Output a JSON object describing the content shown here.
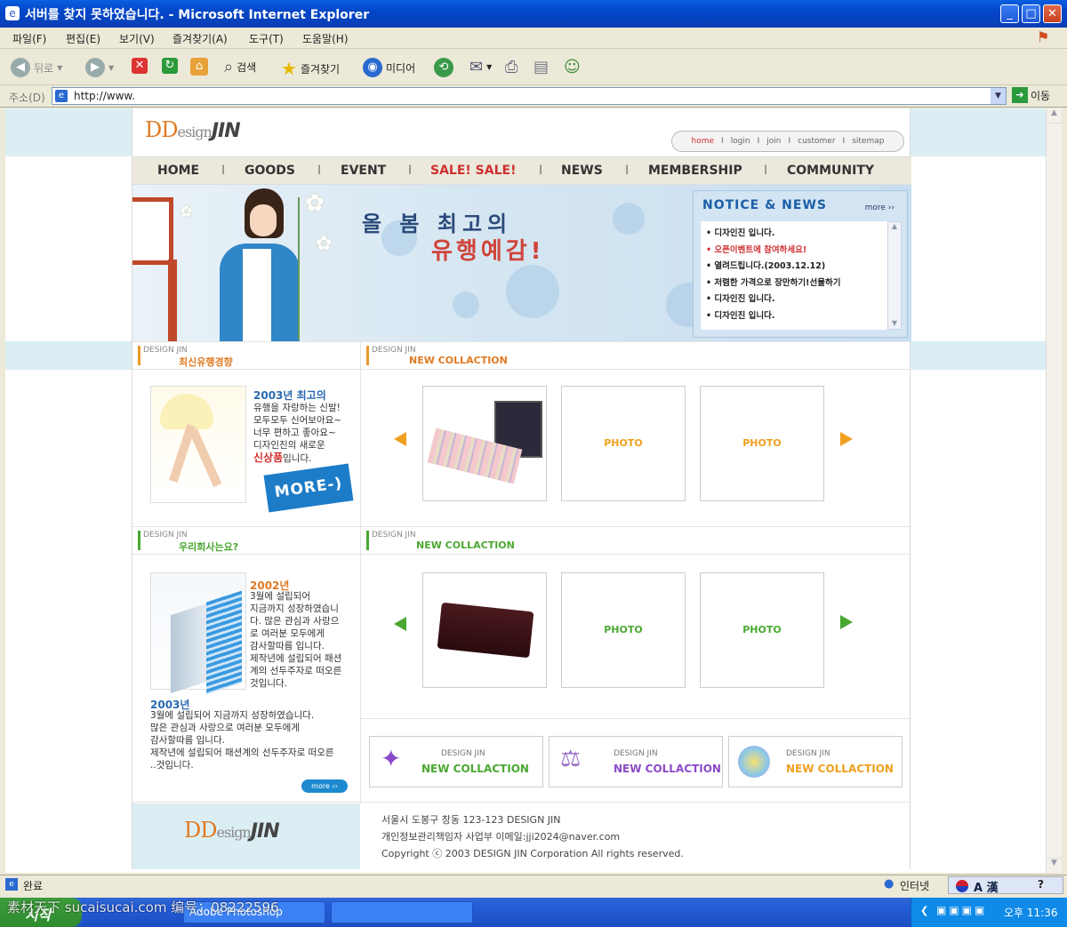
{
  "window": {
    "title": "서버를 찾지 못하였습니다. - Microsoft Internet Explorer"
  },
  "menu": [
    "파일(F)",
    "편집(E)",
    "보기(V)",
    "즐겨찾기(A)",
    "도구(T)",
    "도움말(H)"
  ],
  "toolbar": {
    "back": "뒤로",
    "search": "검색",
    "favorites": "즐겨찾기",
    "media": "미디어"
  },
  "address": {
    "label": "주소(D)",
    "value": "http://www.",
    "go": "이동"
  },
  "site": {
    "logo_d": "DD",
    "logo_esign": "esign",
    "logo_jin": "JIN",
    "topnav": [
      "home",
      "login",
      "join",
      "customer",
      "sitemap"
    ],
    "gnb": [
      "HOME",
      "GOODS",
      "EVENT",
      "SALE! SALE!",
      "NEWS",
      "MEMBERSHIP",
      "COMMUNITY"
    ],
    "gnb_sep": "I",
    "banner_line1": "올 봄 최고의",
    "banner_line2": "유행예감!",
    "notice": {
      "title": "NOTICE & NEWS",
      "more": "more ››",
      "items": [
        "디자인진 입니다.",
        "오픈이벤트에 참여하세요!",
        "열려드립니다.(2003.12.12)",
        "저렴한 가격으로 장만하기!선물하기",
        "디자인진 입니다.",
        "디자인진 입니다."
      ]
    },
    "section_small": "DESIGN JIN",
    "sec1_title": "최신유행경향",
    "sec2_title": "NEW COLLACTION",
    "sec3_title": "우리회사는요?",
    "sec4_title": "NEW COLLACTION",
    "trend": {
      "heading": "2003년 최고의",
      "lines": [
        "유행을 자랑하는 신발!",
        "모두모두 신어보아요~",
        "너무 편하고 좋아요~",
        "디자인진의 새로운"
      ],
      "highlight": "신상품",
      "tail": "입니다.",
      "more_btn": "MORE-)"
    },
    "photo_label": "PHOTO",
    "company": {
      "year1": "2002년",
      "lines1": [
        "3월에 설립되어",
        "지금까지 성장하였습니",
        "다. 많은 관심과 사랑으",
        "로 여러분 모두에게",
        "감사할따름 입니다.",
        "제작년에 설립되어 패션",
        "계의 선두주자로 떠오른",
        "것입니다."
      ],
      "year2": "2003년",
      "lines2": [
        "3월에 설립되어 지금까지 성장하였습니다.",
        "많은 관심과 사랑으로 여러분 모두에게",
        "감사할따름 입니다.",
        "제작년에 설립되어 패션계의 선두주자로 떠오른",
        "..것입니다."
      ],
      "more_btn": "more ››"
    },
    "collections": [
      {
        "small": "DESIGN JIN",
        "big": "NEW COLLACTION"
      },
      {
        "small": "DESIGN JIN",
        "big": "NEW COLLACTION"
      },
      {
        "small": "DESIGN JIN",
        "big": "NEW COLLACTION"
      }
    ],
    "footer": [
      "서울시 도봉구 창동 123-123 DESIGN JIN",
      "개인정보관리책임자 사업부 이메일:jji2024@naver.com",
      "Copyright ⓒ 2003 DESIGN JIN Corporation All rights reserved."
    ]
  },
  "status": {
    "left": "완료",
    "zone": "인터넷"
  },
  "taskbar": {
    "start": "시작",
    "task1": "Adobe Photoshop",
    "clock": "오후 11:36",
    "ime": "A 漢"
  },
  "watermark": "素材天下 sucaisucai.com  编号：08222596",
  "colors": {
    "titlebar": "#0346c8",
    "accent_orange": "#e07a24",
    "accent_green": "#4aa832",
    "accent_red": "#d03030",
    "band": "#dbeef3"
  }
}
